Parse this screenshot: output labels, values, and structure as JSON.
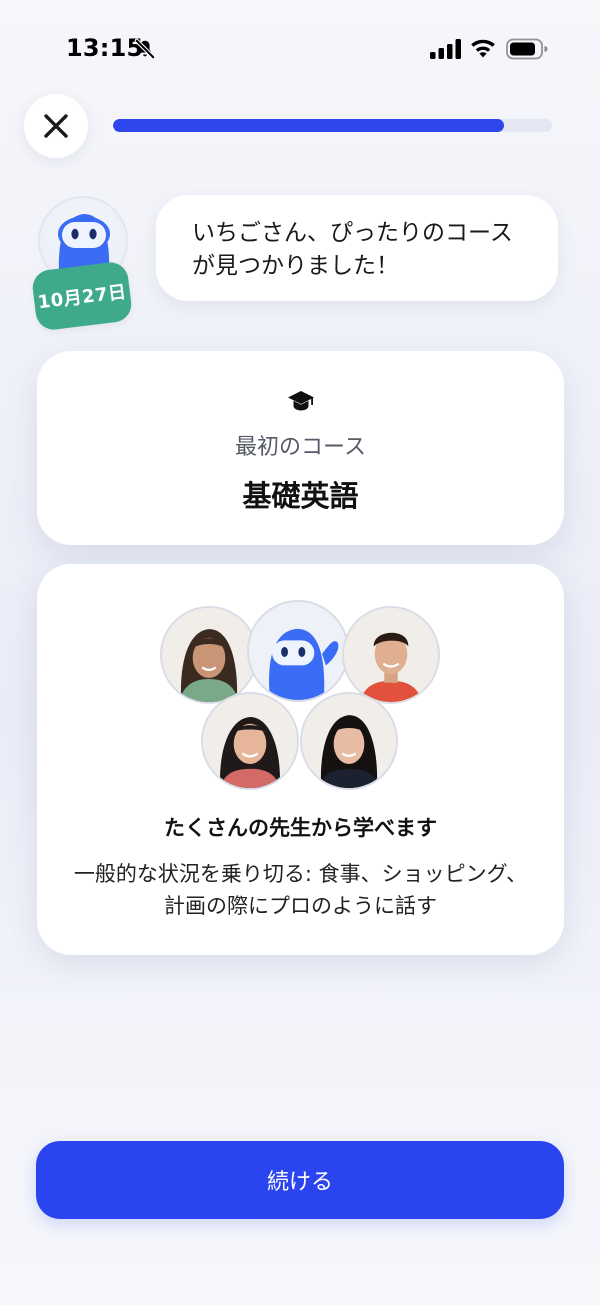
{
  "status_bar": {
    "time": "13:15",
    "icons": [
      "bell-slash-icon",
      "signal-icon",
      "wifi-icon",
      "battery-icon"
    ]
  },
  "header": {
    "close_icon": "close-icon",
    "progress_fraction": 0.89
  },
  "chat": {
    "avatar": "mascot-icon",
    "date_badge": "10月27日",
    "message": "いちごさん、ぴったりのコースが見つかりました！"
  },
  "course_card": {
    "icon": "graduation-cap-icon",
    "label": "最初のコース",
    "course_name": "基礎英語"
  },
  "teachers_card": {
    "avatars": [
      "teacher-1",
      "mascot",
      "teacher-2",
      "teacher-3",
      "teacher-4"
    ],
    "title": "たくさんの先生から学べます",
    "description": "一般的な状況を乗り切る: 食事、ショッピング、計画の際にプロのように話す"
  },
  "footer": {
    "continue_label": "続ける"
  },
  "colors": {
    "accent": "#2e46ec",
    "badge": "#3fa98c",
    "mascot": "#3b6cf5"
  }
}
